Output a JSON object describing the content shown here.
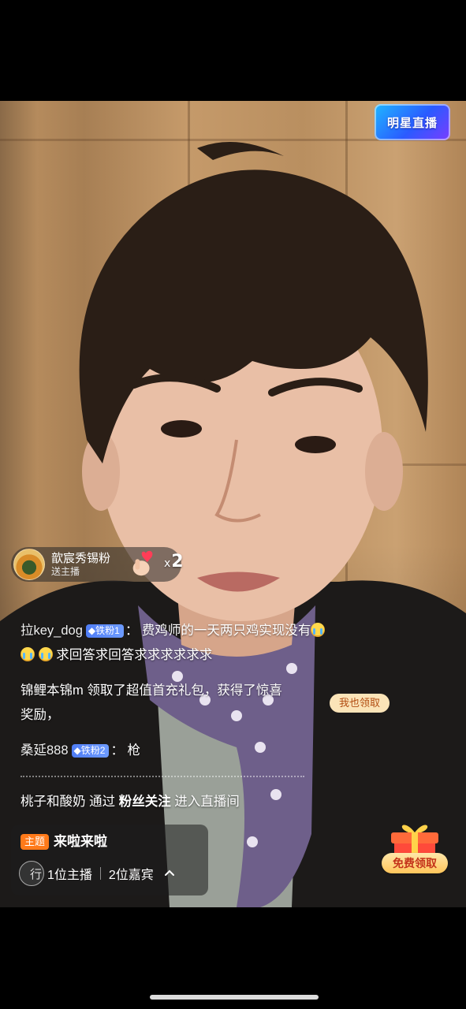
{
  "top_badge": {
    "label": "明星直播"
  },
  "gift_notice": {
    "sender": "歆宸秀锡粉",
    "action": "送主播",
    "count_prefix": "x",
    "count": "2"
  },
  "chat": [
    {
      "user": "拉key_dog",
      "badge": "铁粉1",
      "separator": "：",
      "text_line1": "费鸡师的一天两只鸡实现没有",
      "text_line2": "求回答求回答求求求求求求"
    },
    {
      "text_line1": "锦鲤本锦m 领取了超值首充礼包，获得了惊喜",
      "text_line2": "奖励，",
      "button": "我也领取"
    },
    {
      "user": "桑延888",
      "badge": "铁粉2",
      "separator": "：",
      "text": "枪"
    },
    {
      "user": "桃子和酸奶",
      "via": "通过",
      "source": "粉丝关注",
      "action": "进入直播间"
    }
  ],
  "topic": {
    "tag": "主题",
    "text": "来啦来啦",
    "hosts": "1位主播",
    "guests": "2位嘉宾"
  },
  "free_gift": {
    "label": "免费领取"
  }
}
